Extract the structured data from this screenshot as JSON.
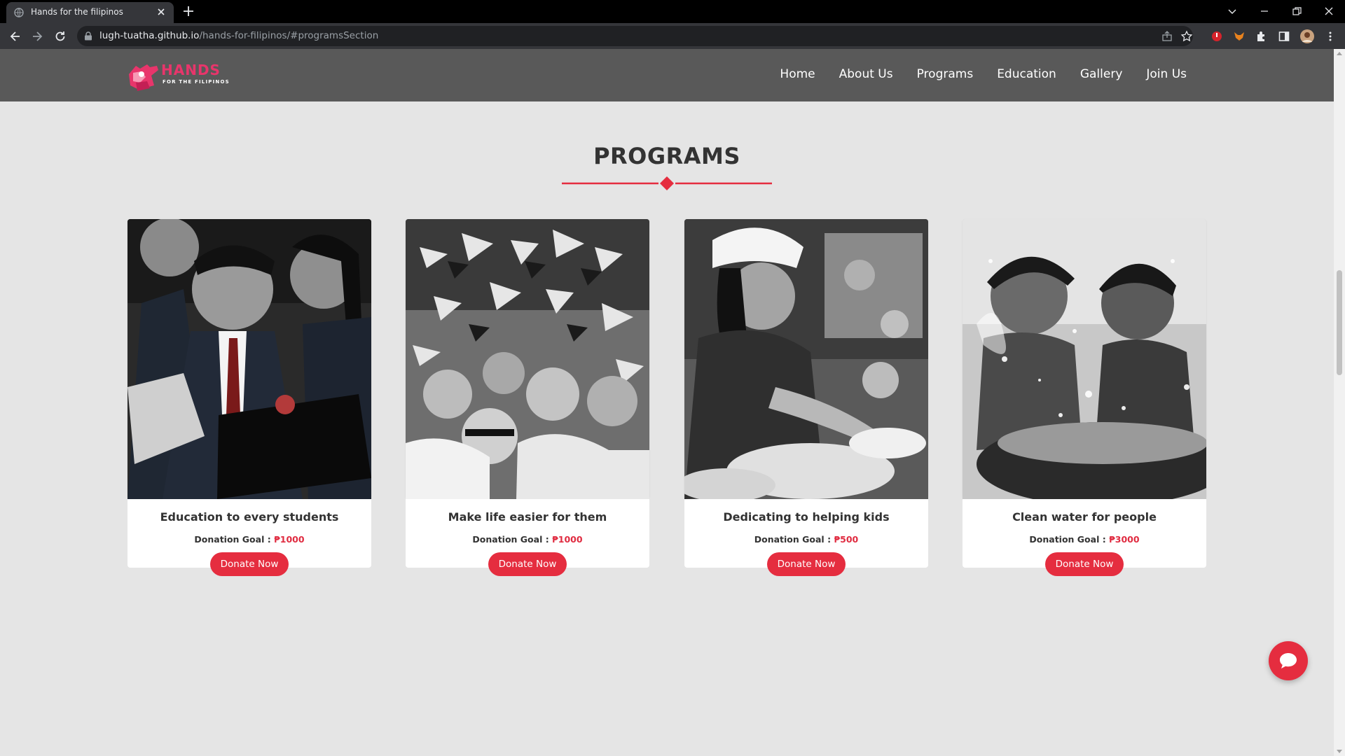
{
  "browser": {
    "tab_title": "Hands for the filipinos",
    "url_host": "lugh-tuatha.github.io",
    "url_path": "/hands-for-filipinos/#programsSection"
  },
  "site": {
    "logo_main": "HANDS",
    "logo_sub": "FOR THE FILIPINOS",
    "nav": [
      "Home",
      "About Us",
      "Programs",
      "Education",
      "Gallery",
      "Join Us"
    ]
  },
  "section": {
    "title": "PROGRAMS"
  },
  "programs": [
    {
      "title": "Education to every students",
      "goal_label": "Donation Goal :",
      "goal_amount": "₱1000",
      "button": "Donate Now",
      "photo": "students-photo"
    },
    {
      "title": "Make life easier for them",
      "goal_label": "Donation Goal :",
      "goal_amount": "₱1000",
      "button": "Donate Now",
      "photo": "crowd-flags-photo"
    },
    {
      "title": "Dedicating to helping kids",
      "goal_label": "Donation Goal :",
      "goal_amount": "₱500",
      "button": "Donate Now",
      "photo": "feeding-kids-photo"
    },
    {
      "title": "Clean water for people",
      "goal_label": "Donation Goal :",
      "goal_amount": "₱3000",
      "button": "Donate Now",
      "photo": "children-water-photo"
    }
  ],
  "colors": {
    "accent": "#e52d3f",
    "nav_bg": "#595959",
    "page_bg": "#e5e5e5",
    "logo_pink": "#e8356b"
  }
}
